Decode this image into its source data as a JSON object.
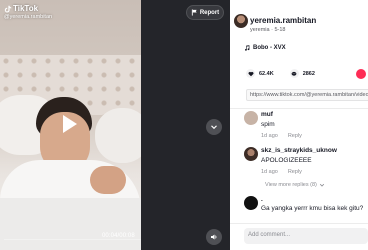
{
  "video": {
    "brand": "TikTok",
    "handle": "@yeremia.rambitan",
    "timecode": "00:04/00:08",
    "report_label": "Report"
  },
  "author": {
    "name": "yeremia.rambitan",
    "meta": "yeremia · 5-18"
  },
  "music": {
    "title": "Bobo - XVX"
  },
  "actions": {
    "likes": "62.4K",
    "comments": "2862"
  },
  "url": "https://www.tiktok.com/@yeremia.rambitan/video/",
  "comments": [
    {
      "name": "muf",
      "text": "spim",
      "time": "1d ago",
      "reply": "Reply",
      "avatar_color": "#c7b3a6"
    },
    {
      "name": "skz_is_straykids_uknow",
      "text": "APOLOGIZEEEE",
      "time": "1d ago",
      "reply": "Reply",
      "avatar_color": "#6f5448"
    },
    {
      "name": ".",
      "text": "Ga yangka yerrr kmu bisa kek gitu?",
      "time": "",
      "reply": "",
      "avatar_color": "#111111"
    }
  ],
  "view_more": "View more replies (8)",
  "add_comment_placeholder": "Add comment...",
  "colors": {
    "like": "#161823",
    "accent": "#fe2c55",
    "share_red": "#fe2c55",
    "share_green": "#25d366"
  }
}
